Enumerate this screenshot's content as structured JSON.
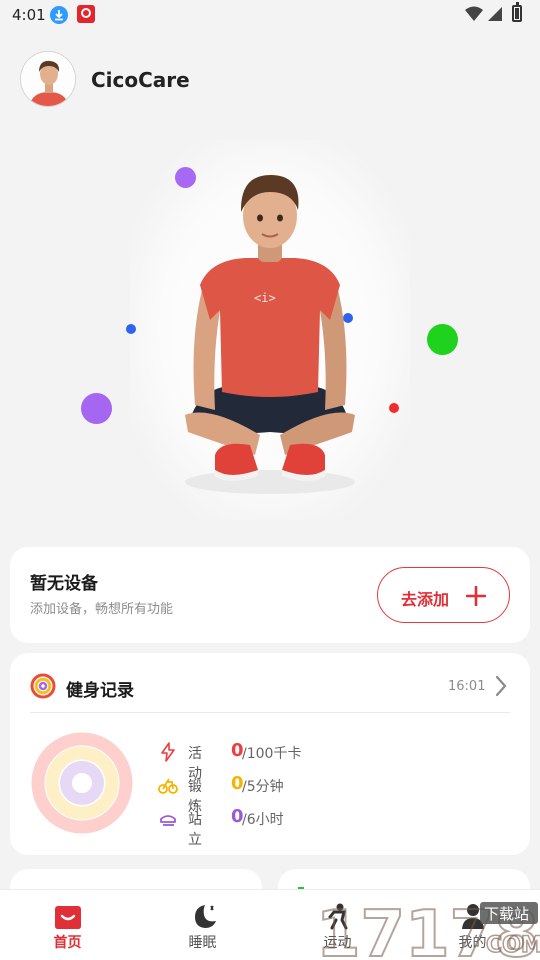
{
  "status_bar": {
    "time": "4:01"
  },
  "header": {
    "brand": "CicoCare"
  },
  "device_card": {
    "title": "暂无设备",
    "subtitle": "添加设备，畅想所有功能",
    "add_label": "去添加"
  },
  "fitness_card": {
    "title": "健身记录",
    "time": "16:01",
    "stats": [
      {
        "name": "活动",
        "value": "0",
        "goal": "/100千卡",
        "color": "#f03c3c",
        "icon": "lightning-icon"
      },
      {
        "name": "锻炼",
        "value": "0",
        "goal": "/5分钟",
        "color": "#f4b400",
        "icon": "bicycle-icon"
      },
      {
        "name": "站立",
        "value": "0",
        "goal": "/6小时",
        "color": "#9b59d6",
        "icon": "standing-icon"
      }
    ]
  },
  "tabs": [
    {
      "label": "首页",
      "active": true,
      "icon": "home-icon"
    },
    {
      "label": "睡眠",
      "active": false,
      "icon": "sleep-moon-icon"
    },
    {
      "label": "运动",
      "active": false,
      "icon": "exercise-icon"
    },
    {
      "label": "我的",
      "active": false,
      "icon": "profile-icon"
    }
  ],
  "watermark": {
    "digits": "17178",
    "site": "下载站",
    "domain": "COM"
  },
  "colors": {
    "accent": "#e02f36",
    "background": "#f3f3f4",
    "card": "#ffffff"
  }
}
